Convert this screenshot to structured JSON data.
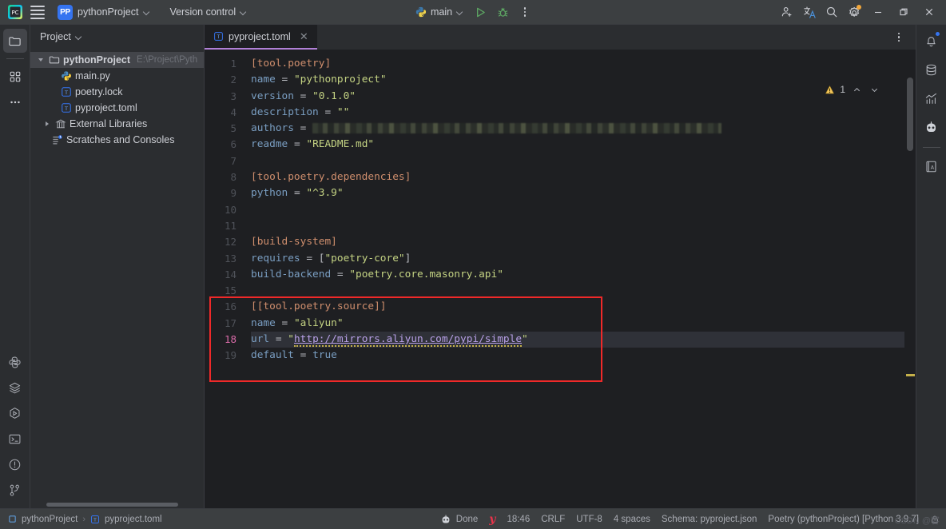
{
  "toolbar": {
    "logo_icon": "pycharm-logo-icon",
    "menu_icon": "hamburger-menu-icon",
    "project_badge": "PP",
    "project_name": "pythonProject",
    "version_control": "Version control",
    "run_config": "main",
    "run_icon": "run-play-icon",
    "debug_icon": "debug-bug-icon",
    "more_icon": "more-vertical-icon",
    "account_icon": "add-account-icon",
    "translate_icon": "translate-icon",
    "search_icon": "search-icon",
    "settings_icon": "gear-icon",
    "minimize_icon": "minimize-icon",
    "maximize_icon": "maximize-restore-icon",
    "close_icon": "window-close-icon"
  },
  "left_rail": {
    "top": [
      {
        "name": "project-tool-window",
        "icon": "folder-icon",
        "active": true
      },
      {
        "name": "commit-tool-window",
        "icon": "commit-squares-icon",
        "active": false
      },
      {
        "name": "more-tool-windows",
        "icon": "ellipsis-icon",
        "active": false
      }
    ],
    "bottom": [
      {
        "name": "python-console",
        "icon": "python-icon"
      },
      {
        "name": "services",
        "icon": "layers-icon"
      },
      {
        "name": "run-tool-window",
        "icon": "run-hexagon-icon"
      },
      {
        "name": "terminal",
        "icon": "terminal-icon"
      },
      {
        "name": "problems",
        "icon": "problems-alert-icon"
      },
      {
        "name": "version-control-tool-window",
        "icon": "branch-icon"
      }
    ]
  },
  "project_panel": {
    "title": "Project",
    "chevron_icon": "chevron-down-icon",
    "tree": [
      {
        "label": "pythonProject",
        "path": "E:\\Project\\Pyth",
        "icon": "folder-icon",
        "indent": 0,
        "twisty": "open",
        "selected": true,
        "bold": true
      },
      {
        "label": "main.py",
        "path": "",
        "icon": "python-file-icon",
        "indent": 1,
        "twisty": "none",
        "selected": false,
        "bold": false
      },
      {
        "label": "poetry.lock",
        "path": "",
        "icon": "toml-file-icon",
        "indent": 1,
        "twisty": "none",
        "selected": false,
        "bold": false
      },
      {
        "label": "pyproject.toml",
        "path": "",
        "icon": "toml-file-icon",
        "indent": 1,
        "twisty": "none",
        "selected": false,
        "bold": false
      },
      {
        "label": "External Libraries",
        "path": "",
        "icon": "library-icon",
        "indent": 0,
        "twisty": "closed",
        "selected": false,
        "bold": false
      },
      {
        "label": "Scratches and Consoles",
        "path": "",
        "icon": "scratches-icon",
        "indent": 0,
        "twisty": "none",
        "selected": false,
        "bold": false
      }
    ]
  },
  "editor": {
    "tab": {
      "label": "pyproject.toml",
      "icon": "toml-file-icon",
      "close_icon": "close-icon"
    },
    "tabbar_more_icon": "more-vertical-icon",
    "inspection": {
      "warning_icon": "warning-triangle-icon",
      "count": "1",
      "prev_icon": "chevron-up-icon",
      "next_icon": "chevron-down-icon"
    },
    "current_line": 18,
    "line_numbers": [
      1,
      2,
      3,
      4,
      5,
      6,
      7,
      8,
      9,
      10,
      11,
      12,
      13,
      14,
      15,
      16,
      17,
      18,
      19
    ],
    "lines": [
      {
        "n": 1,
        "tokens": [
          {
            "t": "[tool.poetry]",
            "c": "sec"
          }
        ]
      },
      {
        "n": 2,
        "tokens": [
          {
            "t": "name",
            "c": "key"
          },
          {
            "t": " = ",
            "c": "eq"
          },
          {
            "t": "\"pythonproject\"",
            "c": "str"
          }
        ]
      },
      {
        "n": 3,
        "tokens": [
          {
            "t": "version",
            "c": "key"
          },
          {
            "t": " = ",
            "c": "eq"
          },
          {
            "t": "\"0.1.0\"",
            "c": "str"
          }
        ]
      },
      {
        "n": 4,
        "tokens": [
          {
            "t": "description",
            "c": "key"
          },
          {
            "t": " = ",
            "c": "eq"
          },
          {
            "t": "\"\"",
            "c": "str"
          }
        ]
      },
      {
        "n": 5,
        "tokens": [
          {
            "t": "authors",
            "c": "key"
          },
          {
            "t": " = ",
            "c": "eq"
          },
          {
            "t": "",
            "c": "redacted"
          }
        ]
      },
      {
        "n": 6,
        "tokens": [
          {
            "t": "readme",
            "c": "key"
          },
          {
            "t": " = ",
            "c": "eq"
          },
          {
            "t": "\"README.md\"",
            "c": "str"
          }
        ]
      },
      {
        "n": 7,
        "tokens": []
      },
      {
        "n": 8,
        "tokens": [
          {
            "t": "[tool.poetry.dependencies]",
            "c": "sec"
          }
        ]
      },
      {
        "n": 9,
        "tokens": [
          {
            "t": "python",
            "c": "key"
          },
          {
            "t": " = ",
            "c": "eq"
          },
          {
            "t": "\"^3.9\"",
            "c": "str"
          }
        ]
      },
      {
        "n": 10,
        "tokens": []
      },
      {
        "n": 11,
        "tokens": []
      },
      {
        "n": 12,
        "tokens": [
          {
            "t": "[build-system]",
            "c": "sec"
          }
        ]
      },
      {
        "n": 13,
        "tokens": [
          {
            "t": "requires",
            "c": "key"
          },
          {
            "t": " = [",
            "c": "eq"
          },
          {
            "t": "\"poetry-core\"",
            "c": "str"
          },
          {
            "t": "]",
            "c": "eq"
          }
        ]
      },
      {
        "n": 14,
        "tokens": [
          {
            "t": "build-backend",
            "c": "key"
          },
          {
            "t": " = ",
            "c": "eq"
          },
          {
            "t": "\"poetry.core.masonry.api\"",
            "c": "str"
          }
        ]
      },
      {
        "n": 15,
        "tokens": []
      },
      {
        "n": 16,
        "tokens": [
          {
            "t": "[[tool.poetry.source]]",
            "c": "sec"
          }
        ]
      },
      {
        "n": 17,
        "tokens": [
          {
            "t": "name",
            "c": "key"
          },
          {
            "t": " = ",
            "c": "eq"
          },
          {
            "t": "\"aliyun\"",
            "c": "str"
          }
        ]
      },
      {
        "n": 18,
        "tokens": [
          {
            "t": "url",
            "c": "key"
          },
          {
            "t": " = ",
            "c": "eq"
          },
          {
            "t": "\"",
            "c": "str"
          },
          {
            "t": "http://mirrors.aliyun.com/pypi/simple",
            "c": "link"
          },
          {
            "t": "\"",
            "c": "str"
          }
        ]
      },
      {
        "n": 19,
        "tokens": [
          {
            "t": "default",
            "c": "key"
          },
          {
            "t": " = ",
            "c": "eq"
          },
          {
            "t": "true",
            "c": "bool"
          }
        ]
      }
    ],
    "annotation_box": {
      "color": "#ef2929",
      "from_line": 16,
      "to_line": 19
    }
  },
  "right_rail": [
    {
      "name": "notifications",
      "icon": "bell-icon",
      "badge": true
    },
    {
      "name": "database",
      "icon": "database-icon",
      "badge": false
    },
    {
      "name": "analytics",
      "icon": "chart-icon",
      "badge": false
    },
    {
      "name": "ai-assistant",
      "icon": "ai-bot-icon",
      "badge": false
    },
    {
      "name": "dictionary",
      "icon": "dictionary-book-icon",
      "badge": false
    }
  ],
  "statusbar": {
    "breadcrumb": [
      {
        "label": "pythonProject",
        "icon": "module-icon"
      },
      {
        "label": "pyproject.toml",
        "icon": "toml-file-icon"
      }
    ],
    "separator": "›",
    "ai_icon": "ai-bot-icon",
    "ai_status": "Done",
    "yandex_mark": "y",
    "time": "18:46",
    "line_separator": "CRLF",
    "encoding": "UTF-8",
    "indent": "4 spaces",
    "schema": "Schema: pyproject.json",
    "interpreter": "Poetry (pythonProject) [Python 3.9.7]",
    "watermark": "CSDN @客",
    "lock_icon": "lock-icon"
  },
  "colors": {
    "accent": "#3574f0",
    "tab_underline": "#b180d7",
    "annotation": "#ef2929",
    "string": "#c4d383",
    "section": "#cf8e6d",
    "key": "#7a9ec2",
    "link": "#b9a1e8",
    "current_line_number": "#d96ba8",
    "warning": "#c4b04a"
  }
}
